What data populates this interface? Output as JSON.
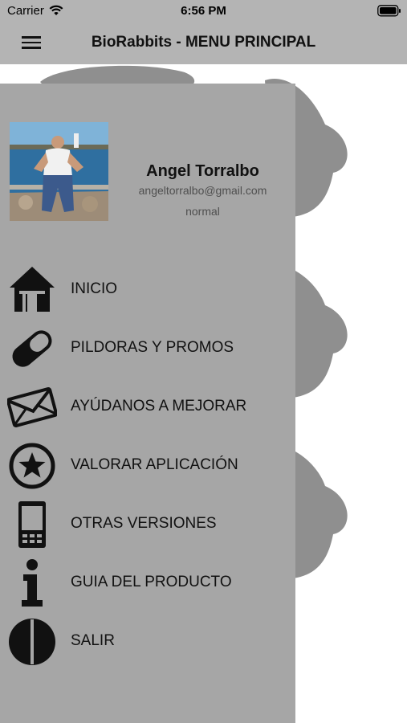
{
  "status_bar": {
    "carrier": "Carrier",
    "time": "6:56 PM"
  },
  "nav": {
    "title": "BioRabbits - MENU PRINCIPAL"
  },
  "profile": {
    "name": "Angel Torralbo",
    "email": "angeltorralbo@gmail.com",
    "status": "normal"
  },
  "menu": [
    {
      "label": "INICIO",
      "icon": "home-icon"
    },
    {
      "label": "PILDORAS Y PROMOS",
      "icon": "pill-icon"
    },
    {
      "label": "AYÚDANOS A MEJORAR",
      "icon": "envelope-icon"
    },
    {
      "label": "VALORAR APLICACIÓN",
      "icon": "star-circle-icon"
    },
    {
      "label": "OTRAS VERSIONES",
      "icon": "phone-icon"
    },
    {
      "label": "GUIA DEL PRODUCTO",
      "icon": "info-icon"
    },
    {
      "label": "SALIR",
      "icon": "exit-icon"
    }
  ]
}
